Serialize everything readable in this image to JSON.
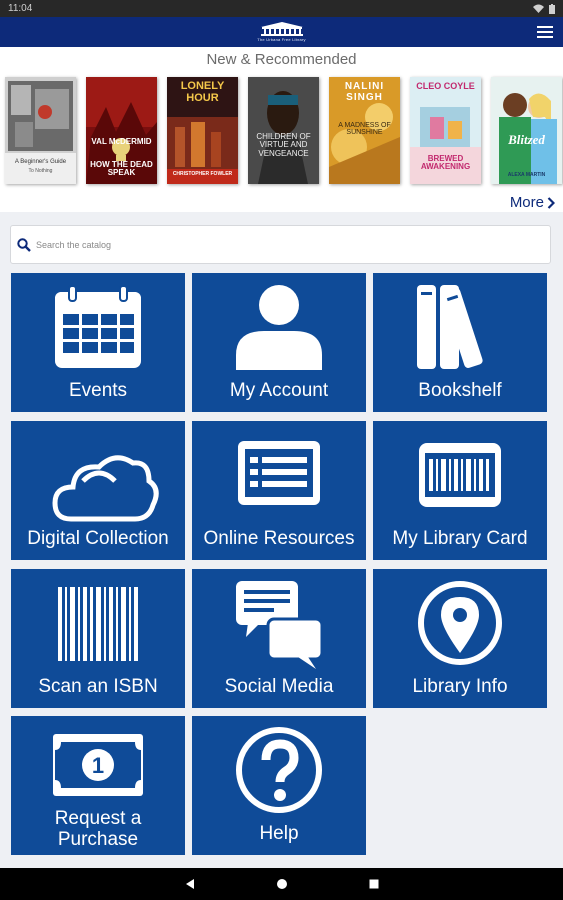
{
  "status_bar": {
    "time": "11:04"
  },
  "header": {
    "logo_caption": "The Urbana Free Library"
  },
  "recommended": {
    "title": "New & Recommended",
    "more_label": "More",
    "books": [
      {
        "name": "book-cover-1",
        "lines": [
          "A Beginner's Guide",
          "To Nothing"
        ]
      },
      {
        "name": "book-cover-2",
        "author": "VAL McDERMID",
        "title": "HOW THE DEAD SPEAK"
      },
      {
        "name": "book-cover-3",
        "title": "LONELY HOUR",
        "author": "CHRISTOPHER FOWLER"
      },
      {
        "name": "book-cover-4",
        "title": "CHILDREN OF VIRTUE AND VENGEANCE"
      },
      {
        "name": "book-cover-5",
        "author": "NALINI SINGH",
        "title": "A MADNESS OF SUNSHINE"
      },
      {
        "name": "book-cover-6",
        "author": "CLEO COYLE",
        "title": "BREWED AWAKENING"
      },
      {
        "name": "book-cover-7",
        "title": "Blitzed",
        "author": "ALEXA MARTIN"
      }
    ]
  },
  "search": {
    "placeholder": "Search the catalog"
  },
  "tiles": [
    {
      "label": "Events"
    },
    {
      "label": "My Account"
    },
    {
      "label": "Bookshelf"
    },
    {
      "label": "Digital Collection"
    },
    {
      "label": "Online Resources"
    },
    {
      "label": "My Library Card"
    },
    {
      "label": "Scan an ISBN"
    },
    {
      "label": "Social Media"
    },
    {
      "label": "Library Info"
    },
    {
      "label": "Request a Purchase"
    },
    {
      "label": "Help"
    }
  ],
  "colors": {
    "app_bar": "#0d2a7a",
    "tile": "#0f4b98",
    "background": "#eef0f4"
  },
  "icons": [
    "calendar-icon",
    "person-icon",
    "books-icon",
    "cloud-icon",
    "list-icon",
    "barcode-card-icon",
    "barcode-icon",
    "chat-icon",
    "location-pin-icon",
    "money-icon",
    "question-icon"
  ]
}
